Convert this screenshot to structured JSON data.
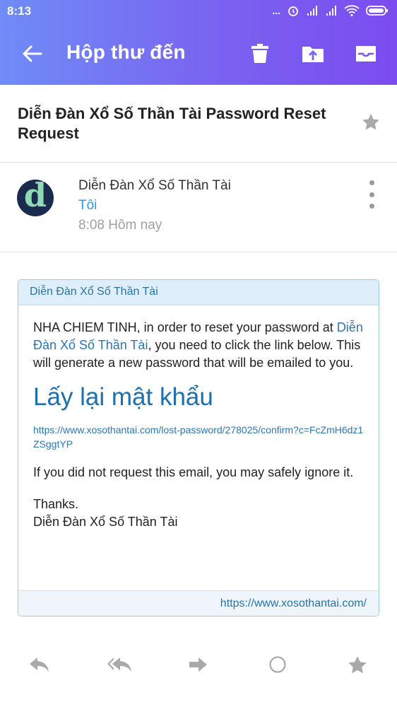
{
  "status_bar": {
    "time": "8:13",
    "dots": "..."
  },
  "toolbar": {
    "title": "Hộp thư đến"
  },
  "email": {
    "subject": "Diễn Đàn Xổ Số Thần Tài Password Reset Request",
    "sender": "Diễn Đàn Xổ Số Thần Tài",
    "avatar_letter": "d",
    "recipient": "Tôi",
    "time": "8:08 Hôm nay"
  },
  "message": {
    "header": "Diễn Đàn Xổ Số Thần Tài",
    "intro_before": "NHA CHIEM TINH, in order to reset your password at ",
    "intro_link": "Diễn Đàn Xổ Số Thần Tài",
    "intro_after": ", you need to click the link below. This will generate a new password that will be emailed to you.",
    "reset_link": "Lấy lại mật khẩu",
    "url": "https://www.xosothantai.com/lost-password/278025/confirm?c=FcZmH6dz1ZSggtYP",
    "ignore_text": "If you did not request this email, you may safely ignore it.",
    "thanks": "Thanks.",
    "signature": "Diễn Đàn Xổ Số Thần Tài",
    "footer_url": "https://www.xosothantai.com/"
  },
  "colors": {
    "header_start": "#6f8cf7",
    "header_end": "#7b4cf0",
    "link": "#2b76b9",
    "recipient": "#2b9be8"
  }
}
